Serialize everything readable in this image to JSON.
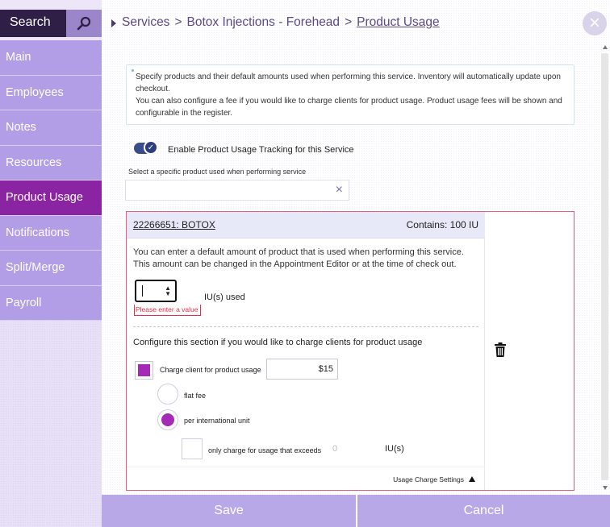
{
  "sidebar": {
    "search_label": "Search",
    "items": [
      {
        "label": "Main"
      },
      {
        "label": "Employees"
      },
      {
        "label": "Notes"
      },
      {
        "label": "Resources"
      },
      {
        "label": "Product Usage"
      },
      {
        "label": "Notifications"
      },
      {
        "label": "Split/Merge"
      },
      {
        "label": "Payroll"
      }
    ],
    "active_item": "Product Usage"
  },
  "breadcrumb": {
    "items": [
      "Services",
      "Botox Injections - Forehead",
      "Product Usage"
    ],
    "separator": ">"
  },
  "close_icon": "×",
  "info": {
    "line1": "Specify products and their default amounts used when performing this service. Inventory will automatically update upon checkout.",
    "line2": "You can also configure a fee if you would like to charge clients for product usage. Product usage fees will be shown and configurable in the register."
  },
  "tracking": {
    "label": "Enable Product Usage Tracking for this Service",
    "enabled": true
  },
  "product_select": {
    "label": "Select a specific product used when performing service",
    "value": "",
    "clear_icon": "×"
  },
  "product": {
    "name": "22266651: BOTOX",
    "contains": "Contains: 100 IU",
    "description_line1": "You can enter a default amount of product that is used when performing this service.",
    "description_line2": "This amount can be changed in the Appointment Editor or at the time of check out.",
    "amount_value": "",
    "amount_unit_label": "IU(s) used",
    "error": "Please enter a value",
    "charge_intro": "Configure this section if you would like to charge clients for product usage",
    "charge_label": "Charge client for product usage",
    "charge_enabled": true,
    "fee_value": "$15",
    "option_flat": "flat fee",
    "option_per_unit": "per international unit",
    "selected_option": "per international unit",
    "exceeds_label": "only charge for usage that exceeds",
    "exceeds_checked": false,
    "exceeds_value": "0",
    "exceeds_unit": "IU(s)",
    "settings_label": "Usage Charge Settings"
  },
  "buttons": {
    "save": "Save",
    "cancel": "Cancel"
  },
  "colors": {
    "sidebar_item": "#b19ee6",
    "sidebar_active": "#8a24a3",
    "search_bg": "#2f1f47",
    "accent_purple": "#a52ab6",
    "error_red": "#e0304a",
    "footer_button": "#b9a8e8"
  }
}
